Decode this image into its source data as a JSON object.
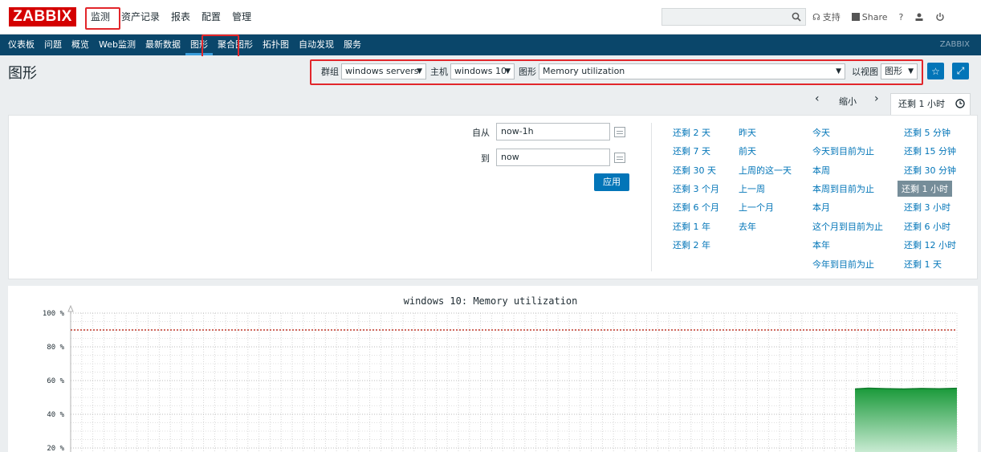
{
  "logo": "ZABBIX",
  "topmenu": [
    "监测",
    "资产记录",
    "报表",
    "配置",
    "管理"
  ],
  "topright": {
    "support": "支持",
    "share": "Share",
    "help": "?"
  },
  "navmenu": [
    "仪表板",
    "问题",
    "概览",
    "Web监测",
    "最新数据",
    "图形",
    "聚合图形",
    "拓扑图",
    "自动发现",
    "服务"
  ],
  "navbrand": "ZABBIX",
  "page_title": "图形",
  "filters": {
    "group_label": "群组",
    "group_value": "windows servers",
    "host_label": "主机",
    "host_value": "windows 10",
    "graph_label": "图形",
    "graph_value": "Memory utilization",
    "view_label": "以视图",
    "view_value": "图形"
  },
  "timectl": {
    "zoom_out": "缩小",
    "active_tab": "还剩 1 小时"
  },
  "timefilter": {
    "from_label": "自从",
    "from_value": "now-1h",
    "to_label": "到",
    "to_value": "now",
    "apply": "应用"
  },
  "quick": {
    "col1": [
      "还剩 2 天",
      "还剩 7 天",
      "还剩 30 天",
      "还剩 3 个月",
      "还剩 6 个月",
      "还剩 1 年",
      "还剩 2 年"
    ],
    "col2": [
      "昨天",
      "前天",
      "上周的这一天",
      "上一周",
      "上一个月",
      "去年"
    ],
    "col3": [
      "今天",
      "今天到目前为止",
      "本周",
      "本周到目前为止",
      "本月",
      "这个月到目前为止",
      "本年",
      "今年到目前为止"
    ],
    "col4": [
      "还剩 5 分钟",
      "还剩 15 分钟",
      "还剩 30 分钟",
      "还剩 1 小时",
      "还剩 3 小时",
      "还剩 6 小时",
      "还剩 12 小时",
      "还剩 1 天"
    ],
    "active": "还剩 1 小时"
  },
  "chart_data": {
    "type": "area",
    "title": "windows 10: Memory utilization",
    "ylim": [
      0,
      100
    ],
    "yticks": [
      "100 %",
      "80 %",
      "60 %",
      "40 %",
      "20 %"
    ],
    "threshold": 90,
    "x": [
      0.885,
      0.9,
      0.92,
      0.94,
      0.96,
      0.98,
      1.0
    ],
    "values": [
      55,
      55.5,
      55.2,
      55,
      55.3,
      55.1,
      55.4
    ],
    "series_color": "#1a9a3a",
    "threshold_color": "#c0392b"
  }
}
